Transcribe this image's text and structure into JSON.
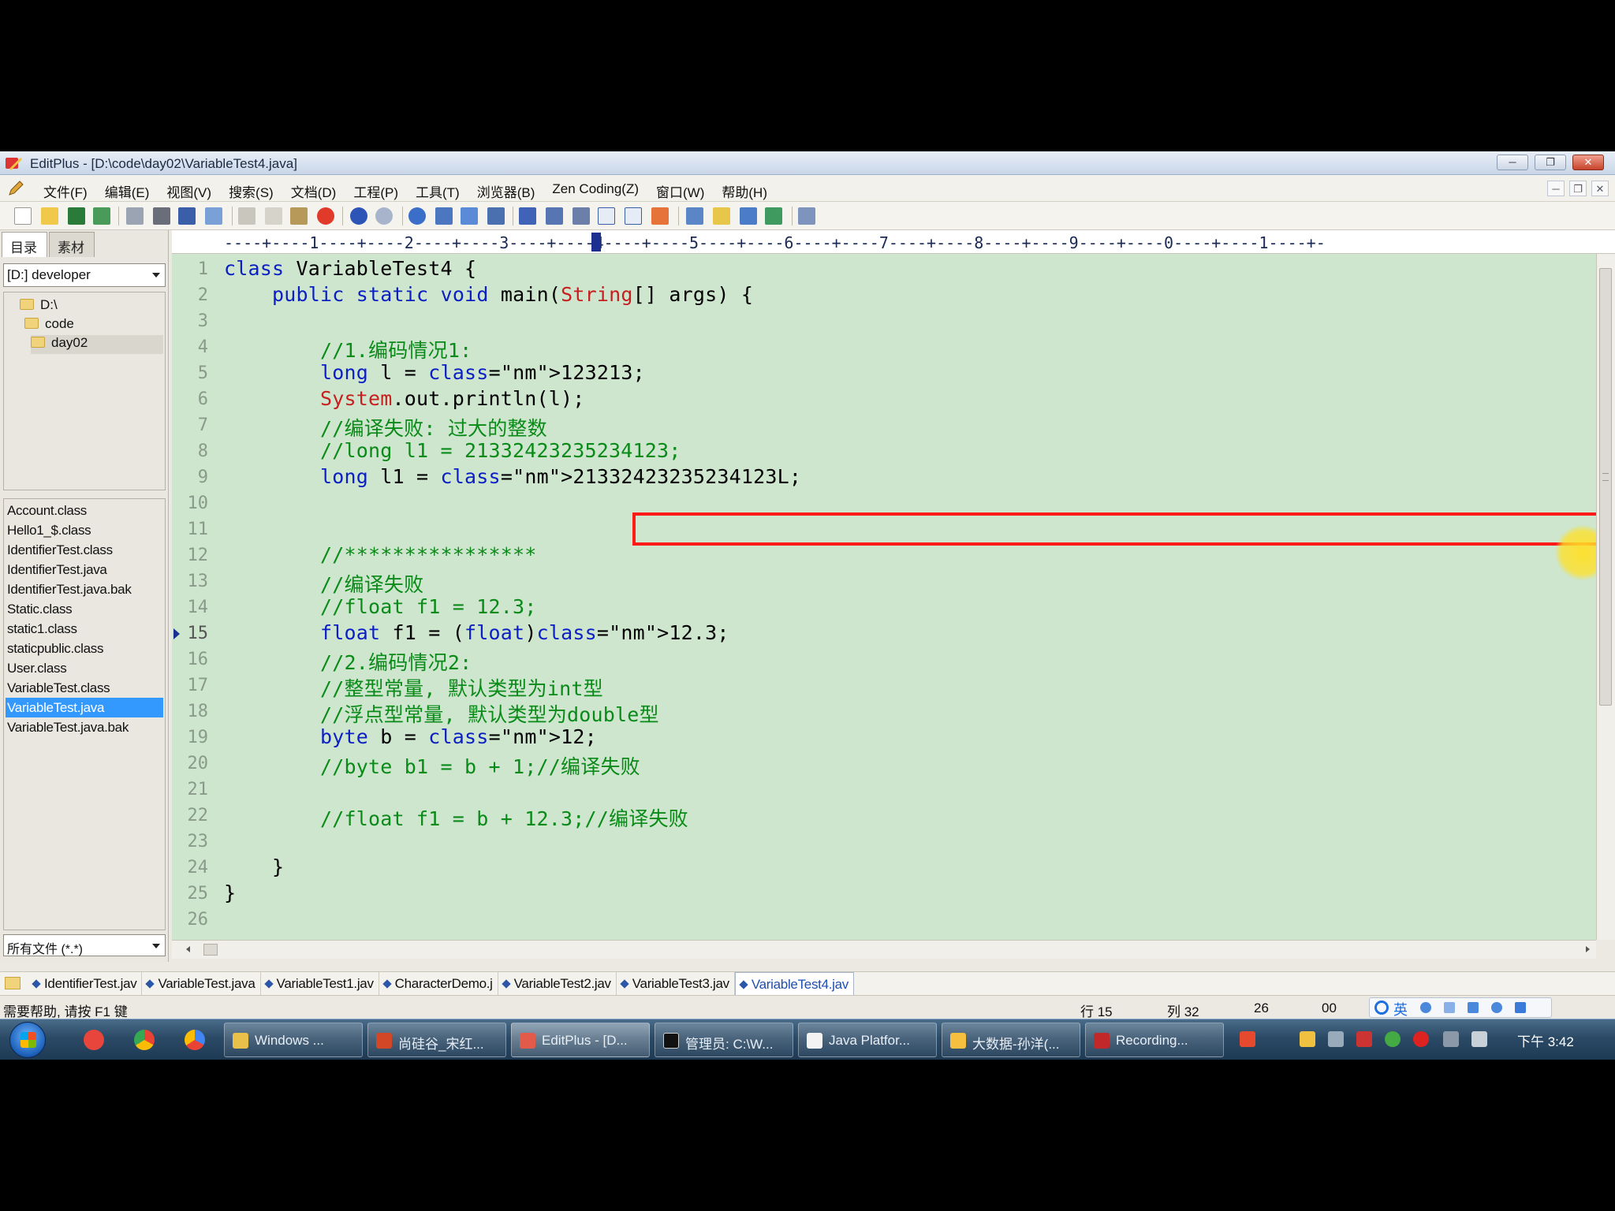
{
  "window": {
    "title": "EditPlus - [D:\\code\\day02\\VariableTest4.java]",
    "controls": [
      "─",
      "❐",
      "✕"
    ]
  },
  "menu": {
    "items": [
      "文件(F)",
      "编辑(E)",
      "视图(V)",
      "搜索(S)",
      "文档(D)",
      "工程(P)",
      "工具(T)",
      "浏览器(B)",
      "Zen Coding(Z)",
      "窗口(W)",
      "帮助(H)"
    ],
    "mdi_controls": [
      "─",
      "❐",
      "✕"
    ]
  },
  "sidebar": {
    "tabs": [
      "目录",
      "素材"
    ],
    "drive": "[D:] developer",
    "folders": [
      "D:\\",
      "code",
      "day02"
    ],
    "files": [
      "Account.class",
      "Hello1_$.class",
      "IdentifierTest.class",
      "IdentifierTest.java",
      "IdentifierTest.java.bak",
      "Static.class",
      "static1.class",
      "staticpublic.class",
      "User.class",
      "VariableTest.class",
      "VariableTest.java",
      "VariableTest.java.bak"
    ],
    "selected_file": "VariableTest.java",
    "filter": "所有文件 (*.*)"
  },
  "ruler": {
    "text": "----+----1----+----2----+----3----+----4----+----5----+----6----+----7----+----8----+----9----+----0----+----1----+-"
  },
  "editor": {
    "current_line": 15,
    "lines": [
      {
        "n": "1",
        "code": "class VariableTest4 {"
      },
      {
        "n": "2",
        "code": "    public static void main(String[] args) {"
      },
      {
        "n": "3",
        "code": ""
      },
      {
        "n": "4",
        "code": "        //1.编码情况1:"
      },
      {
        "n": "5",
        "code": "        long l = 123213;"
      },
      {
        "n": "6",
        "code": "        System.out.println(l);"
      },
      {
        "n": "7",
        "code": "        //编译失败: 过大的整数"
      },
      {
        "n": "8",
        "code": "        //long l1 = 21332423235234123;"
      },
      {
        "n": "9",
        "code": "        long l1 = 21332423235234123L;"
      },
      {
        "n": "10",
        "code": ""
      },
      {
        "n": "11",
        "code": ""
      },
      {
        "n": "12",
        "code": "        //****************"
      },
      {
        "n": "13",
        "code": "        //编译失败"
      },
      {
        "n": "14",
        "code": "        //float f1 = 12.3;"
      },
      {
        "n": "15",
        "code": "        float f1 = (float)12.3;"
      },
      {
        "n": "16",
        "code": "        //2.编码情况2:"
      },
      {
        "n": "17",
        "code": "        //整型常量, 默认类型为int型"
      },
      {
        "n": "18",
        "code": "        //浮点型常量, 默认类型为double型"
      },
      {
        "n": "19",
        "code": "        byte b = 12;"
      },
      {
        "n": "20",
        "code": "        //byte b1 = b + 1;//编译失败"
      },
      {
        "n": "21",
        "code": ""
      },
      {
        "n": "22",
        "code": "        //float f1 = b + 12.3;//编译失败"
      },
      {
        "n": "23",
        "code": ""
      },
      {
        "n": "24",
        "code": "    }"
      },
      {
        "n": "25",
        "code": "}"
      },
      {
        "n": "26",
        "code": ""
      }
    ]
  },
  "doc_tabs": {
    "tabs": [
      "IdentifierTest.jav",
      "VariableTest.java",
      "VariableTest1.jav",
      "CharacterDemo.j",
      "VariableTest2.jav",
      "VariableTest3.jav",
      "VariableTest4.jav"
    ],
    "active": "VariableTest4.jav"
  },
  "status": {
    "help": "需要帮助, 请按 F1 键",
    "line": "行 15",
    "col": "列 32",
    "count": "26",
    "code": "00",
    "ime_lang": "英"
  },
  "taskbar": {
    "tasks": [
      "Windows ...",
      "尚硅谷_宋红...",
      "EditPlus - [D...",
      "管理员: C:\\W...",
      "Java Platfor...",
      "大数据-孙洋(...",
      "Recording..."
    ],
    "active_task": "EditPlus - [D...",
    "clock": "下午 3:42"
  },
  "colors": {
    "editor_bg": "#cde6cd",
    "keyword": "#0b1fc4",
    "comment": "#0a8a18",
    "number": "#a01070",
    "type_class": "#c81e1e",
    "annotation_box": "#ff1a1a",
    "selection": "#3399ff"
  }
}
